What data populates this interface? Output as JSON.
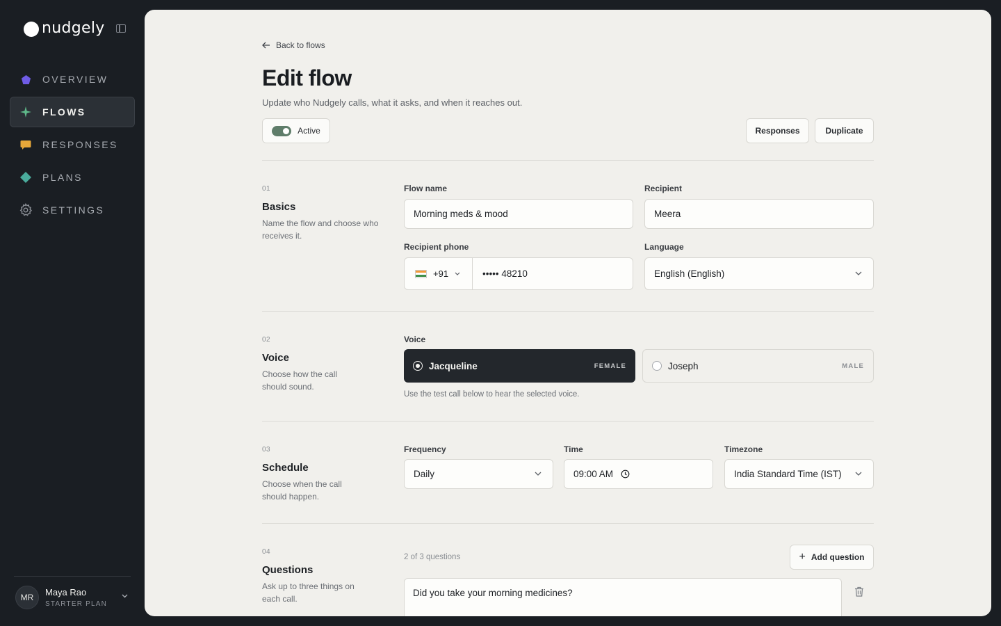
{
  "app": {
    "name": "nudgely"
  },
  "sidebar": {
    "items": [
      {
        "label": "OVERVIEW",
        "icon": "pentagon-icon",
        "color": "#6f5ce6"
      },
      {
        "label": "FLOWS",
        "icon": "sparkle-icon",
        "color": "#5fb98a",
        "active": true
      },
      {
        "label": "RESPONSES",
        "icon": "chat-bubble-icon",
        "color": "#e8a83a"
      },
      {
        "label": "PLANS",
        "icon": "diamond-icon",
        "color": "#4aab9c"
      },
      {
        "label": "SETTINGS",
        "icon": "gear-icon",
        "color": "#8d9198"
      }
    ],
    "user": {
      "initials": "MR",
      "name": "Maya Rao",
      "plan": "STARTER PLAN"
    }
  },
  "header": {
    "back_label": "Back to flows",
    "title": "Edit flow",
    "subtitle": "Update who Nudgely calls, what it asks, and when it reaches out.",
    "status_label": "Active",
    "status_on": true,
    "responses_label": "Responses",
    "duplicate_label": "Duplicate"
  },
  "basics": {
    "num": "01",
    "title": "Basics",
    "desc": "Name the flow and choose who receives it.",
    "flow_name_label": "Flow name",
    "flow_name_value": "Morning meds & mood",
    "recipient_label": "Recipient",
    "recipient_value": "Meera",
    "phone_label": "Recipient phone",
    "phone_country_code": "+91",
    "phone_value": "••••• 48210",
    "language_label": "Language",
    "language_value": "English (English)"
  },
  "voice": {
    "num": "02",
    "title": "Voice",
    "desc": "Choose how the call should sound.",
    "label": "Voice",
    "options": [
      {
        "name": "Jacqueline",
        "gender": "FEMALE",
        "selected": true
      },
      {
        "name": "Joseph",
        "gender": "MALE",
        "selected": false
      }
    ],
    "hint": "Use the test call below to hear the selected voice."
  },
  "schedule": {
    "num": "03",
    "title": "Schedule",
    "desc": "Choose when the call should happen.",
    "frequency_label": "Frequency",
    "frequency_value": "Daily",
    "time_label": "Time",
    "time_value": "09:00 AM",
    "timezone_label": "Timezone",
    "timezone_value": "India Standard Time (IST)"
  },
  "questions": {
    "num": "04",
    "title": "Questions",
    "desc": "Ask up to three things on each call.",
    "count_text": "2 of 3 questions",
    "add_label": "Add question",
    "items": [
      {
        "text": "Did you take your morning medicines?"
      }
    ]
  }
}
